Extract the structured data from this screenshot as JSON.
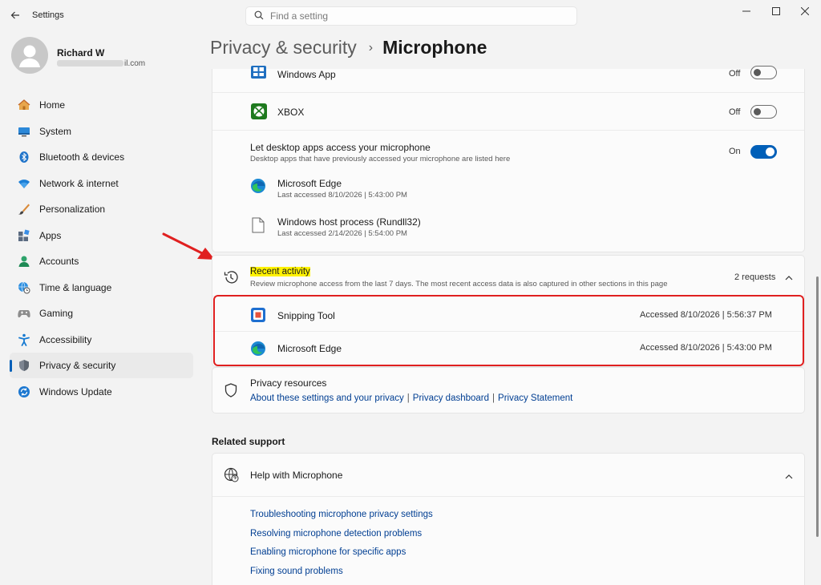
{
  "app": {
    "title": "Settings"
  },
  "search": {
    "placeholder": "Find a setting"
  },
  "user": {
    "name": "Richard W",
    "email_suffix": "il.com"
  },
  "nav": [
    {
      "label": "Home",
      "icon": "home-icon"
    },
    {
      "label": "System",
      "icon": "monitor-icon"
    },
    {
      "label": "Bluetooth & devices",
      "icon": "bluetooth-icon"
    },
    {
      "label": "Network & internet",
      "icon": "wifi-icon"
    },
    {
      "label": "Personalization",
      "icon": "brush-icon"
    },
    {
      "label": "Apps",
      "icon": "apps-icon"
    },
    {
      "label": "Accounts",
      "icon": "person-icon"
    },
    {
      "label": "Time & language",
      "icon": "globe-clock-icon"
    },
    {
      "label": "Gaming",
      "icon": "gamepad-icon"
    },
    {
      "label": "Accessibility",
      "icon": "accessibility-icon"
    },
    {
      "label": "Privacy & security",
      "icon": "shield-icon",
      "active": true
    },
    {
      "label": "Windows Update",
      "icon": "update-icon"
    }
  ],
  "breadcrumb": {
    "parent": "Privacy & security",
    "separator": "›",
    "current": "Microphone"
  },
  "apps_card": {
    "windows_app": {
      "label": "Windows App",
      "state": "Off"
    },
    "xbox": {
      "label": "XBOX",
      "state": "Off"
    },
    "desktop": {
      "title": "Let desktop apps access your microphone",
      "subtitle": "Desktop apps that have previously accessed your microphone are listed here",
      "state": "On",
      "apps": [
        {
          "name": "Microsoft Edge",
          "last": "Last accessed 8/10/2026  |  5:43:00 PM"
        },
        {
          "name": "Windows host process (Rundll32)",
          "last": "Last accessed 2/14/2026  |  5:54:00 PM"
        }
      ]
    }
  },
  "recent": {
    "title": "Recent activity",
    "subtitle": "Review microphone access from the last 7 days. The most recent access data is also captured in other sections in this page",
    "count": "2 requests",
    "items": [
      {
        "name": "Snipping Tool",
        "accessed": "Accessed 8/10/2026  |  5:56:37 PM"
      },
      {
        "name": "Microsoft Edge",
        "accessed": "Accessed 8/10/2026  |  5:43:00 PM"
      }
    ]
  },
  "privacy_resources": {
    "title": "Privacy resources",
    "links": [
      "About these settings and your privacy",
      "Privacy dashboard",
      "Privacy Statement"
    ],
    "separator": "|"
  },
  "related": {
    "title": "Related support",
    "help_title": "Help with Microphone",
    "links": [
      "Troubleshooting microphone privacy settings",
      "Resolving microphone detection problems",
      "Enabling microphone for specific apps",
      "Fixing sound problems"
    ]
  },
  "colors": {
    "accent": "#005fb8",
    "annotation": "#e02020",
    "highlight": "#fff200"
  }
}
